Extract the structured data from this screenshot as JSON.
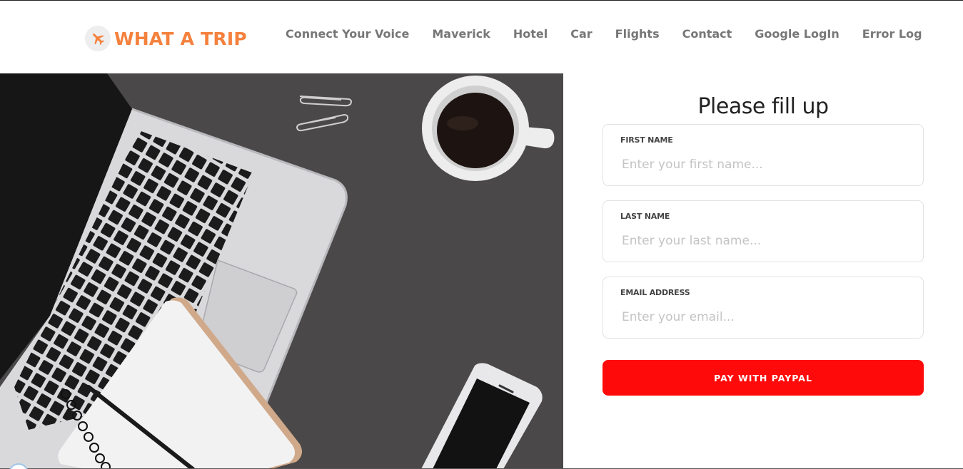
{
  "brand": {
    "name": "WHAT A TRIP",
    "icon": "airplane-icon",
    "color": "#f4813d"
  },
  "nav": {
    "items": [
      "Connect Your Voice",
      "Maverick",
      "Hotel",
      "Car",
      "Flights",
      "Contact",
      "Google LogIn",
      "Error Log"
    ]
  },
  "form": {
    "title": "Please fill up",
    "fields": [
      {
        "label": "FIRST NAME",
        "placeholder": "Enter your first name...",
        "value": ""
      },
      {
        "label": "LAST NAME",
        "placeholder": "Enter your last name...",
        "value": ""
      },
      {
        "label": "EMAIL ADDRESS",
        "placeholder": "Enter your email...",
        "value": ""
      }
    ],
    "submit_label": "PAY WITH PAYPAL",
    "submit_color": "#ff0a0a"
  }
}
